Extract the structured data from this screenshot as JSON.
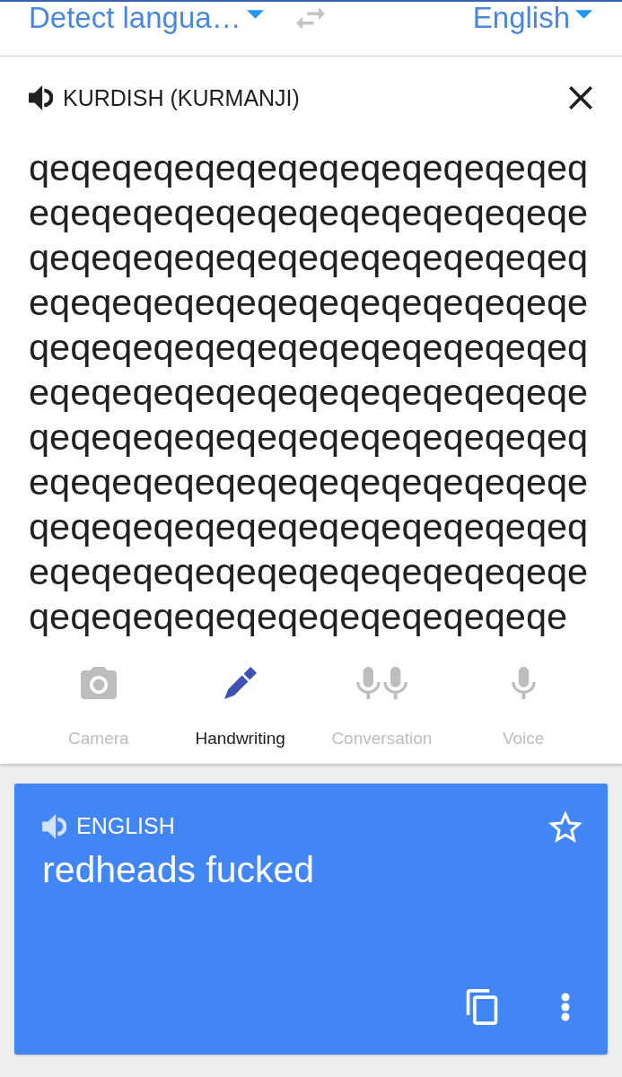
{
  "toolbar": {
    "source_language": "Detect langua…",
    "target_language": "English"
  },
  "source": {
    "language": "KURDISH (KURMANJI)",
    "text": "qeqeqeqeqeqeqeqeqeqeqeqeqeqeqeqeqeqeqeqeqeqeqeqeqeqeqeqeqeqeqeqeqeqeqeqeqeqeqeqeqeqeqeqeqeqeqeqeqeqeqeqeqeqeqeqeqeqeqeqeqeqeqeqeqeqeqeqeqeqeqeqeqeqeqeqeqeqeqeqeqeqeqeqeqeqeqeqeqeqeqeqeqeqeqeqeqeqeqeqeqeqeqeqeqeqeqeqeqeqeqeqeqeqeqeqeqeqeqeqeqeqeqeqeqeqeqeqeqeqeqeqeqeqeqeqeqeqeqeqeqeqeqeqeqeqeqeqe"
  },
  "input_modes": [
    {
      "label": "Camera",
      "kind": "camera",
      "selected": false
    },
    {
      "label": "Handwriting",
      "kind": "handwriting",
      "selected": true
    },
    {
      "label": "Conversation",
      "kind": "conversation",
      "selected": false
    },
    {
      "label": "Voice",
      "kind": "voice",
      "selected": false
    }
  ],
  "translation": {
    "language": "ENGLISH",
    "text": "redheads fucked",
    "starred": false
  }
}
